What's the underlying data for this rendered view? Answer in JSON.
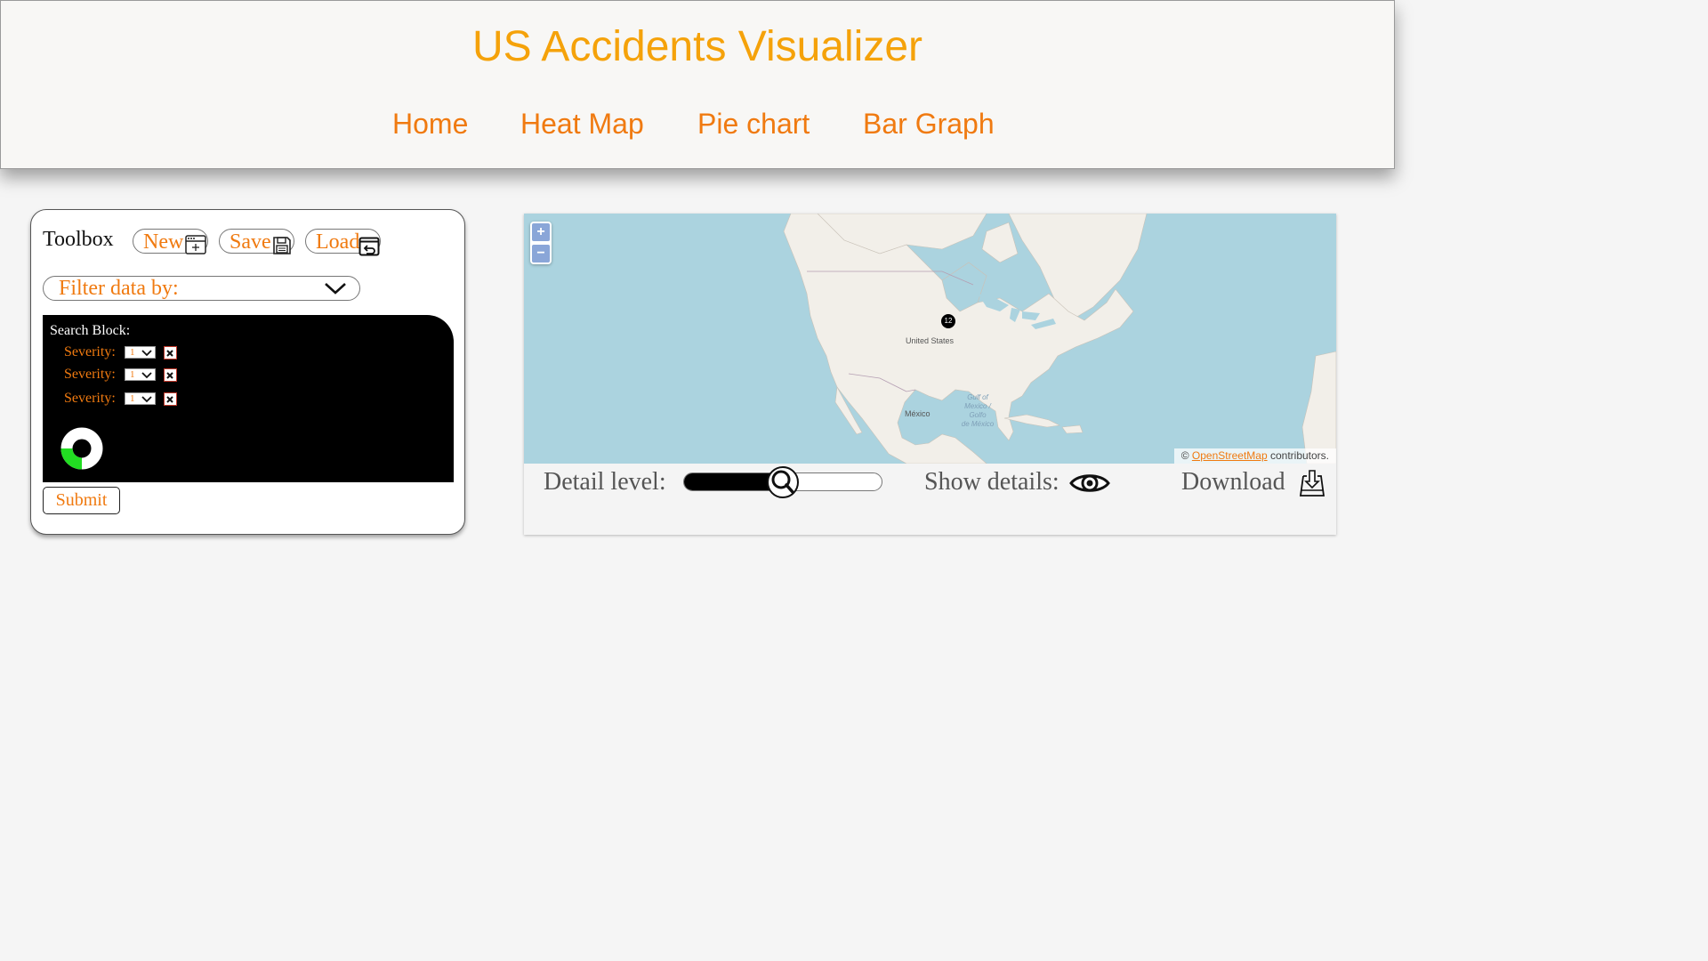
{
  "header": {
    "title": "US Accidents Visualizer",
    "nav": [
      "Home",
      "Heat Map",
      "Pie chart",
      "Bar Graph"
    ]
  },
  "toolbox": {
    "title": "Toolbox",
    "buttons": {
      "new": {
        "label": "New",
        "icon": "new-window-icon"
      },
      "save": {
        "label": "Save",
        "icon": "floppy-disk-icon"
      },
      "load": {
        "label": "Load",
        "icon": "load-return-icon"
      }
    },
    "filter": {
      "label": "Filter data by:",
      "icon": "chevron-down-icon"
    },
    "search_block": {
      "title": "Search Block:",
      "rows": [
        {
          "label": "Severity:",
          "value": "1"
        },
        {
          "label": "Severity:",
          "value": "1"
        },
        {
          "label": "Severity:",
          "value": "1"
        }
      ],
      "progress_fraction": 0.25,
      "progress_color": "#22dd22"
    },
    "submit_label": "Submit"
  },
  "map": {
    "zoom_in": "+",
    "zoom_out": "−",
    "labels": {
      "united_states": "United States",
      "mexico": "México",
      "gulf": "Gulf of Mexico / Golfo de México",
      "gulf_lines": [
        "Gulf of",
        "Mexico /",
        "Golfo",
        "de México"
      ]
    },
    "cluster_count": "12",
    "attribution": {
      "prefix": "©",
      "link": "OpenStreetMap",
      "suffix": "contributors."
    }
  },
  "controls": {
    "detail_label": "Detail level:",
    "detail_level": 0.5,
    "show_details_label": "Show details:",
    "show_details_icon": "eye-icon",
    "download_label": "Download",
    "download_icon": "download-icon"
  },
  "colors": {
    "accent": "#f07a10",
    "title": "#f5a20a",
    "water": "#abd3df",
    "land": "#f2efe9"
  }
}
